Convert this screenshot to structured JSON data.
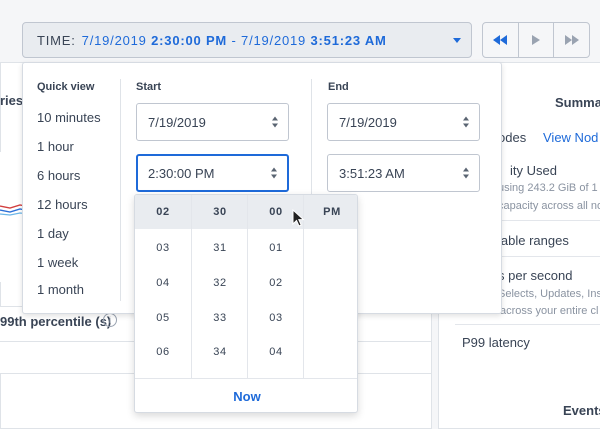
{
  "timebar": {
    "label": "TIME:",
    "start_date": "7/19/2019",
    "start_time": "2:30:00 PM",
    "separator": "-",
    "end_date": "7/19/2019",
    "end_time": "3:51:23 AM"
  },
  "nav": {
    "rewind_icon": "double-left-arrow-icon",
    "play_icon": "play-icon",
    "forward_icon": "double-right-arrow-icon"
  },
  "background": {
    "left_fragment": "ries",
    "percentile_label": "99th percentile (s)",
    "summary": "Summar",
    "nodes": "odes",
    "view_nodes": "View Nod",
    "capacity_used": "ity Used",
    "capacity_sub1": "using 243.2 GiB of 1",
    "capacity_sub2": "capacity across all no",
    "ranges": "lable ranges",
    "per_second": "s per second",
    "per_second_sub1": "Selects, Updates, Inse",
    "per_second_sub2": "across your entire cl",
    "p99": "P99 latency",
    "events": "Events"
  },
  "quick_view": {
    "title": "Quick view",
    "items": [
      "10 minutes",
      "1 hour",
      "6 hours",
      "12 hours",
      "1 day",
      "1 week",
      "1 month"
    ]
  },
  "start": {
    "title": "Start",
    "date": "7/19/2019",
    "time": "2:30:00 PM"
  },
  "end": {
    "title": "End",
    "date": "7/19/2019",
    "time": "3:51:23 AM"
  },
  "picker": {
    "hours": [
      "02",
      "03",
      "04",
      "05",
      "06"
    ],
    "minutes": [
      "30",
      "31",
      "32",
      "33",
      "34"
    ],
    "seconds": [
      "00",
      "01",
      "02",
      "03",
      "04"
    ],
    "ampm": [
      "PM"
    ],
    "now_label": "Now"
  },
  "colors": {
    "accent": "#1e6ad9",
    "text": "#394455",
    "selected_bg": "#e9ecf0"
  }
}
